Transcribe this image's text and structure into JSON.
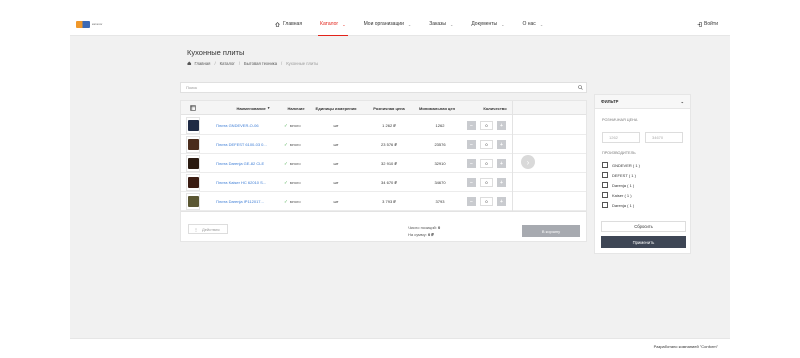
{
  "brand": {
    "logo_sub": "каталог"
  },
  "nav": {
    "items": [
      {
        "label": "Главная"
      },
      {
        "label": "Каталог"
      },
      {
        "label": "Мои организации"
      },
      {
        "label": "Заказы"
      },
      {
        "label": "Документы"
      },
      {
        "label": "О нас"
      }
    ],
    "active_index": 1,
    "login_label": "Войти"
  },
  "page": {
    "title": "Кухонные плиты"
  },
  "breadcrumb": [
    "Главная",
    "Каталог",
    "Бытовая техника",
    "Кухонные плиты"
  ],
  "search": {
    "placeholder": "Поиск"
  },
  "table": {
    "columns": [
      "Наименование",
      "Наличие",
      "Единицы измерения",
      "Розничная цена",
      "Минимальная цен",
      "Количество"
    ],
    "sort_indicator": "▾",
    "rows": [
      {
        "name": "Плита GNDEVER-O-06",
        "availability": "много",
        "available_icon": "check-icon",
        "unit": "шт",
        "retail_price": "1 262 ₽",
        "min_price": "1262",
        "qty": "0",
        "thumb_color": "#1e2a44"
      },
      {
        "name": "Плита DEFEST 6100-03 0...",
        "availability": "много",
        "available_icon": "check-icon",
        "unit": "шт",
        "retail_price": "23 576 ₽",
        "min_price": "23576",
        "qty": "0",
        "thumb_color": "#4a2c1c"
      },
      {
        "name": "Плита Darenja GE-82 CLE",
        "availability": "много",
        "available_icon": "check-icon",
        "unit": "шт",
        "retail_price": "32 910 ₽",
        "min_price": "32910",
        "qty": "0",
        "thumb_color": "#2a1a10"
      },
      {
        "name": "Плита Kaiser HC 62010 S...",
        "availability": "много",
        "available_icon": "check-icon",
        "unit": "шт",
        "retail_price": "34 670 ₽",
        "min_price": "34670",
        "qty": "0",
        "thumb_color": "#3a1c12"
      },
      {
        "name": "Плита Darenja IP112017...",
        "availability": "много",
        "available_icon": "check-icon",
        "unit": "шт",
        "retail_price": "3 793 ₽",
        "min_price": "3793",
        "qty": "0",
        "thumb_color": "#5a5632"
      }
    ],
    "actions_label": "Действия",
    "totals_count_label": "Число позиций:",
    "totals_count": "0",
    "totals_sum_label": "На сумму:",
    "totals_sum": "0 ₽",
    "cart_button": "В корзину"
  },
  "filter": {
    "title": "ФИЛЬТР",
    "price_label": "РОЗНИЧНАЯ ЦЕНА",
    "price_min_placeholder": "1262",
    "price_max_placeholder": "34670",
    "maker_label": "ПРОИЗВОДИТЕЛЬ",
    "makers": [
      "GNDEVER ( 1 )",
      "DEFEST ( 1 )",
      "Darenja ( 1 )",
      "Kaiser ( 1 )",
      "Darenja ( 1 )"
    ],
    "reset_label": "Сбросить",
    "apply_label": "Применить"
  },
  "footer": {
    "text": "Разработано компанией \"Conform\""
  }
}
